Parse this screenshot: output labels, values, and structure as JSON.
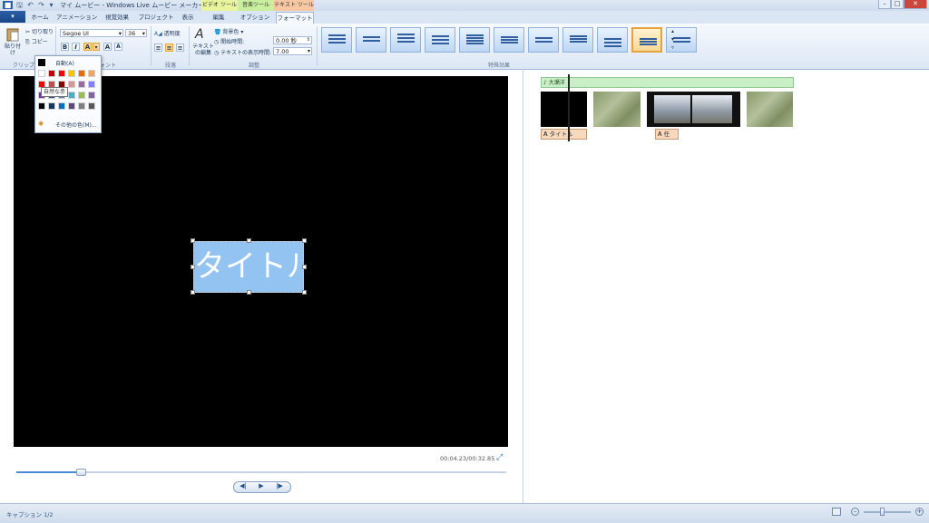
{
  "window": {
    "title": "マイ ムービー - Windows Live ムービー メーカー",
    "context_tabs": {
      "video_tools": "ビデオ ツール",
      "music_tools": "音楽ツール",
      "text_tools": "テキスト ツール"
    },
    "controls": {
      "minimize": "–",
      "maximize": "□",
      "close": "✕"
    }
  },
  "quick_access": {
    "save_icon": "🖫",
    "undo_icon": "↶",
    "redo_icon": "↷",
    "more_icon": "▾"
  },
  "tabs": [
    {
      "label": "ホーム"
    },
    {
      "label": "アニメーション"
    },
    {
      "label": "視覚効果"
    },
    {
      "label": "プロジェクト"
    },
    {
      "label": "表示"
    },
    {
      "label": "編集"
    },
    {
      "label": "オプション"
    },
    {
      "label": "フォーマット"
    }
  ],
  "file_button": "▾",
  "ribbon": {
    "clipboard": {
      "paste": "貼り付け",
      "cut": "切り取り",
      "copy": "コピー",
      "group_label": "クリップボ"
    },
    "font": {
      "family": "Segoe UI",
      "size": "36",
      "bold": "B",
      "italic": "I",
      "color_btn": "A",
      "grow": "A",
      "shrink": "A",
      "group_label": "フォント"
    },
    "paragraph": {
      "transparency": "透明度",
      "group_label": "段落"
    },
    "adjust": {
      "edit_text": "テキストの編集",
      "bg_color": "背景色",
      "start_time_label": "開始時間:",
      "start_time_value": "0.00 秒",
      "duration_label": "テキストの表示時間:",
      "duration_value": "7.00",
      "group_label": "調整"
    },
    "effects": {
      "group_label": "特殊効果",
      "count": 11,
      "selected_index": 9
    }
  },
  "color_popup": {
    "auto_label": "自動(A)",
    "tooltip": "自然な赤",
    "more_colors": "その他の色(M)...",
    "colors": [
      "#ffffff",
      "#c00000",
      "#ff0000",
      "#ffc000",
      "#e36c09",
      "#f7a35c",
      "#ff0000",
      "#c0504d",
      "#8b0000",
      "#d99694",
      "#9b6b9b",
      "#7f7fff",
      "#7030a0",
      "#1f497d",
      "#4f81bd",
      "#4bacc6",
      "#9bbb59",
      "#8064a2",
      "#000000",
      "#17365d",
      "#0070c0",
      "#5f497a",
      "#7f7f7f",
      "#595959"
    ]
  },
  "preview": {
    "title_text": "タイトル",
    "timecode": "00:04.23/00:32.85",
    "progress": 0.13,
    "fullscreen_icon": "⤢",
    "prev_frame": "◀|",
    "play": "▶",
    "next_frame": "|▶"
  },
  "storyboard": {
    "music_label": "♪ 大瀬洋",
    "captions": [
      "𝐀 タイトル",
      "𝐀 任"
    ]
  },
  "status": {
    "text": "キャプション 1/2"
  }
}
